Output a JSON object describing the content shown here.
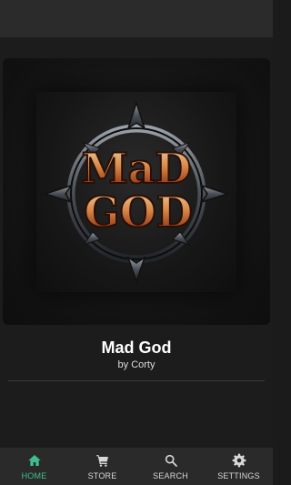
{
  "album": {
    "title": "Mad God",
    "artist": "by Corty",
    "cover_text_line1": "MaD",
    "cover_text_line2": "GOD"
  },
  "nav": {
    "items": [
      {
        "label": "HOME",
        "icon": "home-icon",
        "active": true
      },
      {
        "label": "STORE",
        "icon": "cart-icon",
        "active": false
      },
      {
        "label": "SEARCH",
        "icon": "search-icon",
        "active": false
      },
      {
        "label": "SETTINGS",
        "icon": "gear-icon",
        "active": false
      }
    ]
  },
  "colors": {
    "accent": "#3fbf8f",
    "background": "#1c1c1c",
    "nav_background": "#2a2a2a"
  }
}
